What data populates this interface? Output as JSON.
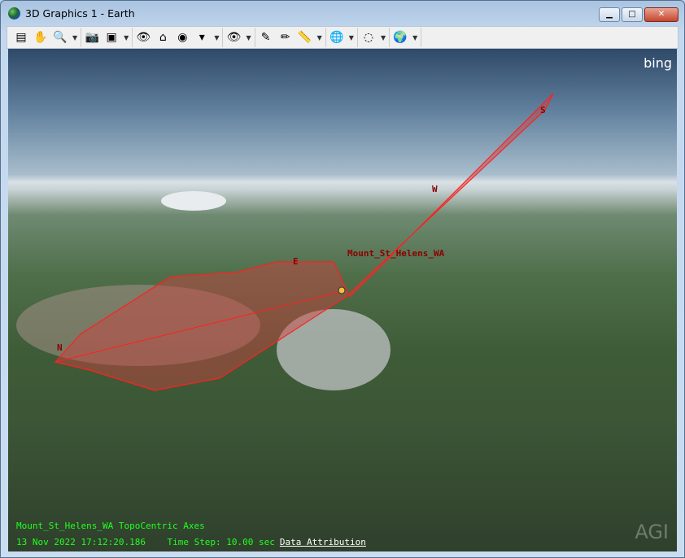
{
  "window": {
    "title": "3D Graphics 1 - Earth",
    "minimize": "▁",
    "maximize": "□",
    "close": "✕"
  },
  "toolbar": {
    "groups": [
      [
        {
          "icon": "properties-icon",
          "g": "▤"
        },
        {
          "icon": "pan-icon",
          "g": "✋"
        },
        {
          "icon": "zoom-icon",
          "g": "🔍"
        }
      ],
      [
        {
          "icon": "snapshot-icon",
          "g": "📷"
        },
        {
          "icon": "record-movie-icon",
          "g": "▣"
        }
      ],
      [
        {
          "icon": "view-from-to-icon",
          "g": "👁"
        },
        {
          "icon": "home-view-icon",
          "g": "⌂"
        },
        {
          "icon": "north-up-icon",
          "g": "◉"
        },
        {
          "icon": "orient-top-icon",
          "g": "▾"
        }
      ],
      [
        {
          "icon": "view-transform-icon",
          "g": "👁"
        }
      ],
      [
        {
          "icon": "light-icon",
          "g": "✎"
        },
        {
          "icon": "annotation-pencil-icon",
          "g": "✏"
        },
        {
          "icon": "measure-icon",
          "g": "📏"
        }
      ],
      [
        {
          "icon": "globe-manager-icon",
          "g": "🌐"
        }
      ],
      [
        {
          "icon": "disabled-cd-icon",
          "g": "◌"
        }
      ],
      [
        {
          "icon": "terrain-icon",
          "g": "🌍"
        }
      ]
    ]
  },
  "view": {
    "logo": "bing",
    "labels": {
      "object": "Mount_St_Helens_WA",
      "n": "N",
      "e": "E",
      "w": "W",
      "s": "S"
    },
    "overlay_line1": "Mount_St_Helens_WA TopoCentric Axes",
    "date_time": "13 Nov 2022 17:12:20.186",
    "time_step": "Time Step: 10.00 sec",
    "data_attribution": "Data Attribution",
    "watermark": "AGI",
    "colors": {
      "sensor_fill": "#d04040",
      "sensor_line": "#ff2020",
      "overlay_text": "#20ff20"
    }
  }
}
